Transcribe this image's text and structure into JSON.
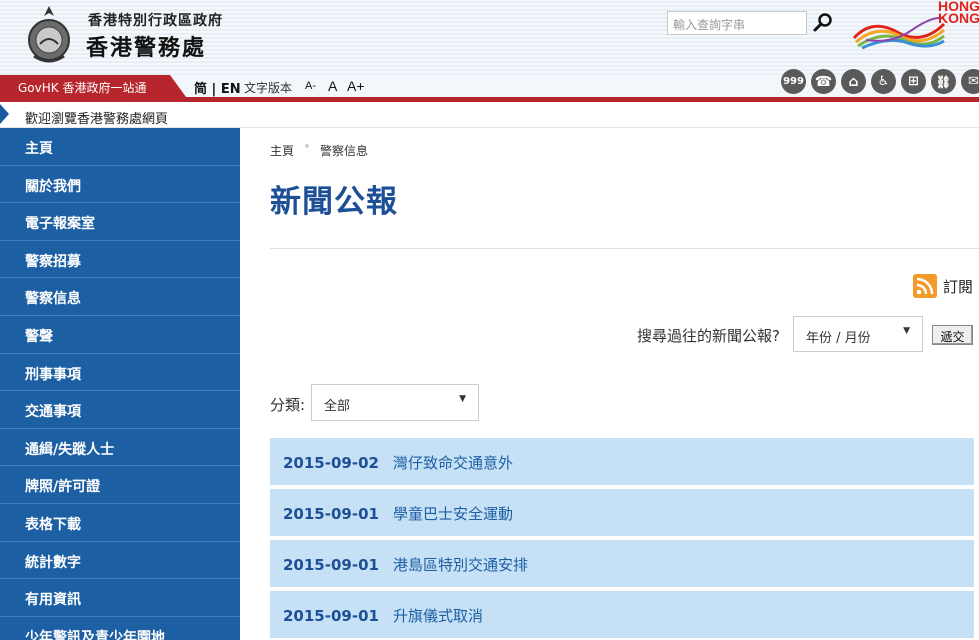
{
  "header": {
    "dept_small": "香港特別行政區政府",
    "dept_big": "香港警務處",
    "search_placeholder": "輸入查詢字串",
    "brand_line1": "HONG",
    "brand_line2": "KONG"
  },
  "toolbar": {
    "govhk_label": "GovHK 香港政府一站通",
    "lang_simplified": "简",
    "lang_english": "EN",
    "text_version": "文字版本",
    "font_small": "A-",
    "font_normal": "A",
    "font_large": "A+",
    "icons": [
      {
        "name": "emergency-999-icon",
        "label": "999"
      },
      {
        "name": "phone-icon",
        "label": "☎"
      },
      {
        "name": "police-station-icon",
        "label": "⌂"
      },
      {
        "name": "accessibility-icon",
        "label": "♿"
      },
      {
        "name": "sitemap-icon",
        "label": "⊞"
      },
      {
        "name": "link-icon",
        "label": "⛓"
      },
      {
        "name": "mail-icon",
        "label": "✉"
      }
    ],
    "accent_color": "#b7262c"
  },
  "welcome": "歡迎瀏覽香港警務處網頁",
  "sidebar": {
    "items": [
      {
        "label": "主頁"
      },
      {
        "label": "關於我們"
      },
      {
        "label": "電子報案室"
      },
      {
        "label": "警察招募"
      },
      {
        "label": "警察信息"
      },
      {
        "label": "警聲"
      },
      {
        "label": "刑事事項"
      },
      {
        "label": "交通事項"
      },
      {
        "label": "通緝/失蹤人士"
      },
      {
        "label": "牌照/許可證"
      },
      {
        "label": "表格下載"
      },
      {
        "label": "統計數字"
      },
      {
        "label": "有用資訊"
      },
      {
        "label": "少年警訊及青少年園地"
      }
    ]
  },
  "main": {
    "breadcrumb": [
      "主頁",
      "警察信息"
    ],
    "breadcrumb_sep": "˚",
    "title": "新聞公報",
    "rss_label": "訂閱",
    "search_label": "搜尋過往的新聞公報?",
    "month_select": "年份 / 月份",
    "submit_label": "遞交",
    "category_label": "分類:",
    "category_select": "全部",
    "news": [
      {
        "date": "2015-09-02",
        "title": "灣仔致命交通意外"
      },
      {
        "date": "2015-09-01",
        "title": "學童巴士安全運動"
      },
      {
        "date": "2015-09-01",
        "title": "港島區特別交通安排"
      },
      {
        "date": "2015-09-01",
        "title": "升旗儀式取消"
      }
    ]
  }
}
